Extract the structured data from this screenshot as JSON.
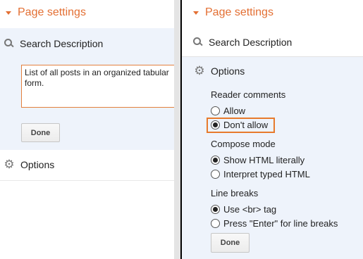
{
  "left_panel": {
    "header_title": "Page settings",
    "search_description": {
      "title": "Search Description",
      "value": "List of all posts in an organized tabular form.",
      "done_label": "Done"
    },
    "options": {
      "title": "Options"
    }
  },
  "right_panel": {
    "header_title": "Page settings",
    "search_description": {
      "title": "Search Description"
    },
    "options": {
      "title": "Options",
      "reader_comments": {
        "label": "Reader comments",
        "options": [
          "Allow",
          "Don't allow"
        ],
        "selected": "Don't allow"
      },
      "compose_mode": {
        "label": "Compose mode",
        "options": [
          "Show HTML literally",
          "Interpret typed HTML"
        ],
        "selected": "Show HTML literally"
      },
      "line_breaks": {
        "label": "Line breaks",
        "options": [
          "Use <br> tag",
          "Press \"Enter\" for line breaks"
        ],
        "selected": "Use <br> tag"
      },
      "done_label": "Done"
    }
  },
  "colors": {
    "accent_orange": "#e36f33",
    "section_blue": "#eef3fb",
    "highlight_orange": "#e77a2c"
  },
  "icons": {
    "collapse": "caret-down-icon",
    "search": "search-icon",
    "options": "gear-icon"
  }
}
